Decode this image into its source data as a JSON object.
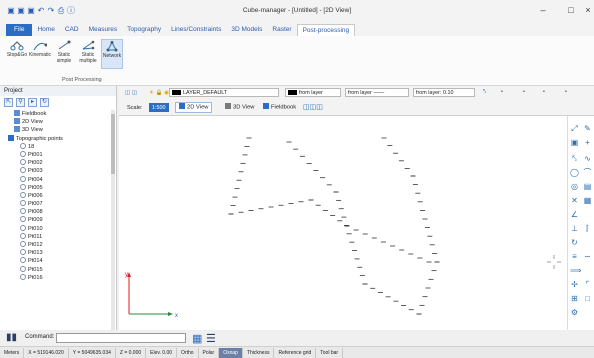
{
  "window": {
    "title": "Cube-manager - [Untitled] - [2D View]"
  },
  "menu": [
    {
      "label": "File",
      "kind": "file"
    },
    {
      "label": "Home",
      "kind": "normal"
    },
    {
      "label": "CAD",
      "kind": "normal"
    },
    {
      "label": "Measures",
      "kind": "normal"
    },
    {
      "label": "Topography",
      "kind": "normal"
    },
    {
      "label": "Lines/Constraints",
      "kind": "normal"
    },
    {
      "label": "3D Models",
      "kind": "normal"
    },
    {
      "label": "Raster",
      "kind": "normal"
    },
    {
      "label": "Post-processing",
      "kind": "active"
    }
  ],
  "ribbon": {
    "buttons": [
      {
        "label": "Stop&Go"
      },
      {
        "label": "Kinematic"
      },
      {
        "label": "Static simple"
      },
      {
        "label": "Static multiple"
      },
      {
        "label": "Network"
      }
    ],
    "group_label": "Post Processing"
  },
  "project": {
    "title": "Project",
    "tree": [
      {
        "label": "Fieldbook",
        "level": 1
      },
      {
        "label": "2D View",
        "level": 1
      },
      {
        "label": "3D View",
        "level": 1
      },
      {
        "label": "Topographic points",
        "level": 0
      },
      {
        "label": "18",
        "level": 2
      },
      {
        "label": "Pt001",
        "level": 2
      },
      {
        "label": "Pt002",
        "level": 2
      },
      {
        "label": "Pt003",
        "level": 2
      },
      {
        "label": "Pt004",
        "level": 2
      },
      {
        "label": "Pt005",
        "level": 2
      },
      {
        "label": "Pt006",
        "level": 2
      },
      {
        "label": "Pt007",
        "level": 2
      },
      {
        "label": "Pt008",
        "level": 2
      },
      {
        "label": "Pt009",
        "level": 2
      },
      {
        "label": "Pt010",
        "level": 2
      },
      {
        "label": "Pt011",
        "level": 2
      },
      {
        "label": "Pt012",
        "level": 2
      },
      {
        "label": "Pt013",
        "level": 2
      },
      {
        "label": "Pt014",
        "level": 2
      },
      {
        "label": "Pt015",
        "level": 2
      },
      {
        "label": "Pt016",
        "level": 2
      }
    ]
  },
  "toolbar": {
    "layer": "LAYER_DEFAULT",
    "color_from": "from layer",
    "line_from": "from layer",
    "weight_from": "from layer: 0.10",
    "scale_label": "Scale:",
    "scale_value": "1:500",
    "view2d": "2D View",
    "view3d": "3D View",
    "fieldbook": "Fieldbook"
  },
  "axes": {
    "x": "x",
    "y": "y"
  },
  "command": {
    "label": "Command:",
    "value": ""
  },
  "status": [
    {
      "label": "Meters",
      "on": false
    },
    {
      "label": "X = 519146.020",
      "on": false
    },
    {
      "label": "Y = 5049635.034",
      "on": false
    },
    {
      "label": "Z = 0.000",
      "on": false
    },
    {
      "label": "Elev. 0.00",
      "on": false
    },
    {
      "label": "Ortho",
      "on": false
    },
    {
      "label": "Polar",
      "on": false
    },
    {
      "label": "Osnap",
      "on": true
    },
    {
      "label": "Thickness",
      "on": false
    },
    {
      "label": "Reference grid",
      "on": false
    },
    {
      "label": "Tool bar",
      "on": false
    }
  ]
}
